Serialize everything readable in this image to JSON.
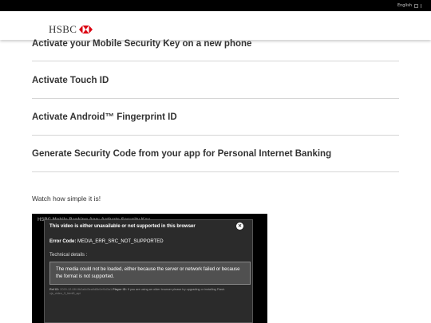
{
  "topbar": {
    "language": "English"
  },
  "header": {
    "logo_text": "HSBC"
  },
  "items": [
    {
      "label": "Activate your Mobile Security Key on a new phone"
    },
    {
      "label": "Activate Touch ID"
    },
    {
      "label": "Activate Android™ Fingerprint ID"
    },
    {
      "label": "Generate Security Code from your app for Personal Internet Banking"
    }
  ],
  "watch_text": "Watch how simple it is!",
  "player": {
    "title": "HSBC Mobile Banking App: Activate Security Key",
    "modal": {
      "title": "This video is either unavailable or not supported in this browser",
      "close_symbol": "✕",
      "error_label": "Error Code:",
      "error_code": "MEDIA_ERR_SRC_NOT_SUPPORTED",
      "technical_label": "Technical details :",
      "message": "The media could not be loaded, either because the server or network failed or because the format is not supported.",
      "ref_label": "Ref ID:",
      "ref_id": "2020-12-08:1fb2a6d3ea9d5b0ef9d3a1",
      "player_label": "Player ID:",
      "player_id": "vjs_video_3_html5_api",
      "flash_note": "If you are using an older browser please try upgrading or installing Flash."
    }
  },
  "colors": {
    "brand_red": "#db0011",
    "text": "#333333",
    "divider": "#d6d6d6",
    "topbar": "#000000",
    "modal_bg": "#2b2b2b"
  }
}
